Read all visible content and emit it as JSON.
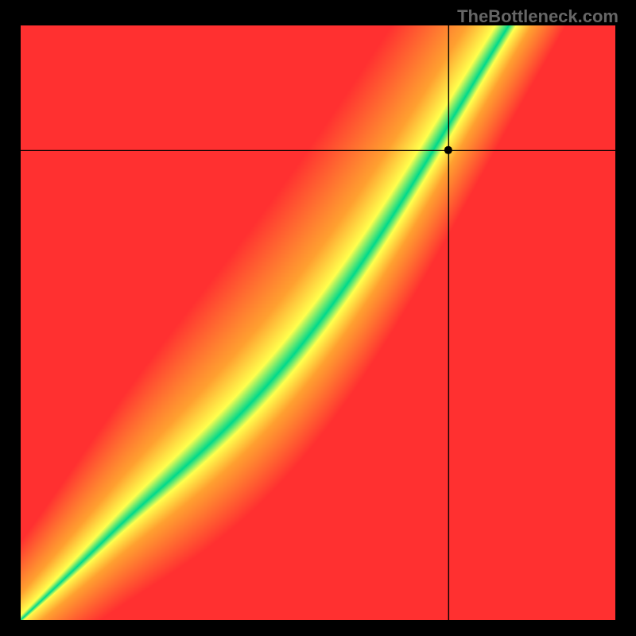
{
  "watermark": "TheBottleneck.com",
  "chart_data": {
    "type": "heatmap",
    "title": "",
    "xlabel": "",
    "ylabel": "",
    "x_range": [
      0,
      1
    ],
    "y_range": [
      0,
      1
    ],
    "marker": {
      "x": 0.72,
      "y": 0.79
    },
    "crosshair": {
      "x": 0.72,
      "y": 0.79
    },
    "optimal_band": {
      "description": "Green diagonal band where GPU and CPU performance are balanced; red at extremes of imbalance; yellow/orange transition",
      "slope_approx": 1.35,
      "curve": "slight S-curve, steeper in middle"
    },
    "color_scale": {
      "optimal": "#00D98B",
      "near": "#FFFF4D",
      "moderate": "#FFA030",
      "poor": "#FF3030"
    }
  }
}
